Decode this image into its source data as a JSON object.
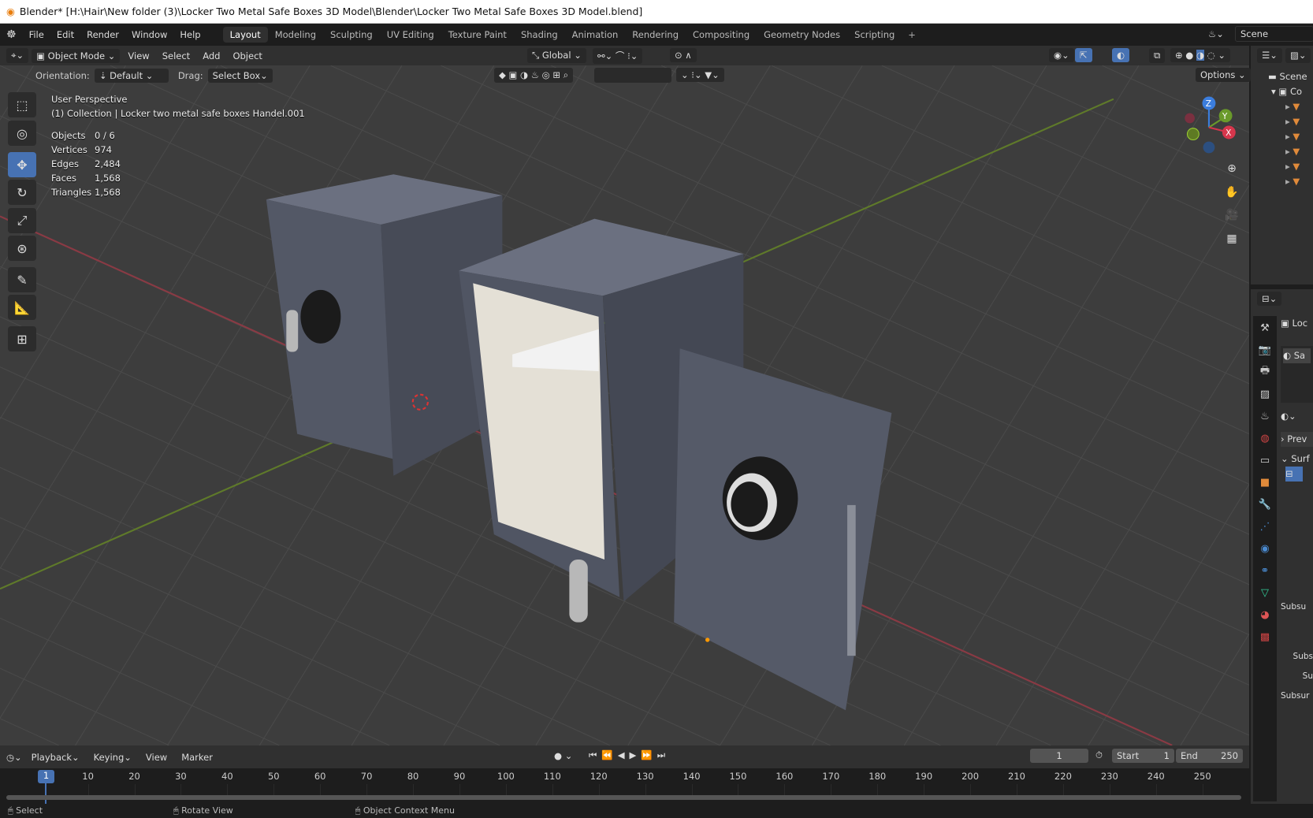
{
  "window": {
    "title": "Blender* [H:\\Hair\\New folder (3)\\Locker Two Metal Safe Boxes 3D Model\\Blender\\Locker Two Metal Safe Boxes 3D Model.blend]"
  },
  "menu": [
    "File",
    "Edit",
    "Render",
    "Window",
    "Help"
  ],
  "workspaces": [
    "Layout",
    "Modeling",
    "Sculpting",
    "UV Editing",
    "Texture Paint",
    "Shading",
    "Animation",
    "Rendering",
    "Compositing",
    "Geometry Nodes",
    "Scripting"
  ],
  "scene": {
    "name": "Scene"
  },
  "header": {
    "mode": "Object Mode",
    "menus": [
      "View",
      "Select",
      "Add",
      "Object"
    ],
    "transform_orientation": "Global",
    "orientation_label": "Orientation:",
    "orientation_value": "Default",
    "drag_label": "Drag:",
    "drag_value": "Select Box",
    "options": "Options"
  },
  "viewport": {
    "view_name": "User Perspective",
    "collection_info": "(1) Collection | Locker two metal safe boxes Handel.001",
    "stats": [
      {
        "label": "Objects",
        "value": "0 / 6"
      },
      {
        "label": "Vertices",
        "value": "974"
      },
      {
        "label": "Edges",
        "value": "2,484"
      },
      {
        "label": "Faces",
        "value": "1,568"
      },
      {
        "label": "Triangles",
        "value": "1,568"
      }
    ],
    "gizmo": {
      "x": "X",
      "y": "Y",
      "z": "Z"
    }
  },
  "outliner": {
    "scene_label": "Scene",
    "collection_label": "Co"
  },
  "properties": {
    "object_label": "Loc",
    "material_slot": "Sa",
    "preview": "Prev",
    "surface": "Surf",
    "labels": [
      "Subsu",
      "Subs",
      "Su",
      "Subsur"
    ]
  },
  "timeline": {
    "menus": [
      "Playback",
      "Keying",
      "View",
      "Marker"
    ],
    "current_frame": "1",
    "start_label": "Start",
    "start": "1",
    "end_label": "End",
    "end": "250",
    "ticks": [
      "10",
      "20",
      "30",
      "40",
      "50",
      "60",
      "70",
      "80",
      "90",
      "100",
      "110",
      "120",
      "130",
      "140",
      "150",
      "160",
      "170",
      "180",
      "190",
      "200",
      "210",
      "220",
      "230",
      "240",
      "250"
    ]
  },
  "statusbar": {
    "items": [
      "Select",
      "Rotate View",
      "Object Context Menu"
    ]
  }
}
